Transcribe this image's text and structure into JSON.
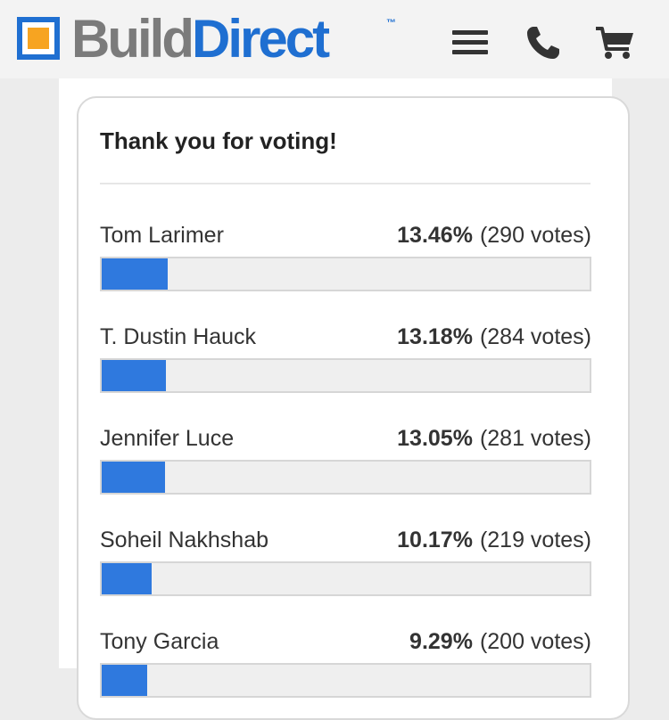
{
  "header": {
    "logo_part1": "Build",
    "logo_part2": "Direct",
    "logo_tm": "™",
    "icons": [
      "menu-icon",
      "phone-icon",
      "cart-icon"
    ],
    "brand_color": "#1f6fd1",
    "logo_accent_color": "#f7a421"
  },
  "poll": {
    "title": "Thank you for voting!",
    "bar_color": "#2f79de",
    "results": [
      {
        "name": "Tom Larimer",
        "percent_label": "13.46%",
        "votes_label": "(290 votes)",
        "fraction": 0.1346
      },
      {
        "name": "T. Dustin Hauck",
        "percent_label": "13.18%",
        "votes_label": "(284 votes)",
        "fraction": 0.1318
      },
      {
        "name": "Jennifer Luce",
        "percent_label": "13.05%",
        "votes_label": "(281 votes)",
        "fraction": 0.1305
      },
      {
        "name": "Soheil Nakhshab",
        "percent_label": "10.17%",
        "votes_label": "(219 votes)",
        "fraction": 0.1017
      },
      {
        "name": "Tony Garcia",
        "percent_label": "9.29%",
        "votes_label": "(200 votes)",
        "fraction": 0.0929
      }
    ]
  }
}
